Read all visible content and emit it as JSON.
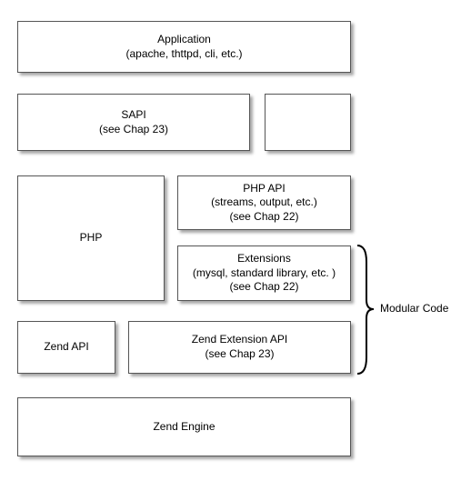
{
  "boxes": {
    "application": {
      "title": "Application",
      "subtitle": "(apache, thttpd, cli, etc.)"
    },
    "sapi": {
      "title": "SAPI",
      "subtitle": "(see Chap 23)"
    },
    "sapi_blank": {
      "title": "",
      "subtitle": ""
    },
    "php": {
      "title": "PHP"
    },
    "php_api": {
      "title": "PHP API",
      "subtitle1": "(streams, output, etc.)",
      "subtitle2": "(see Chap 22)"
    },
    "extensions": {
      "title": "Extensions",
      "subtitle1": "(mysql, standard library, etc. )",
      "subtitle2": "(see Chap 22)"
    },
    "zend_api": {
      "title": "Zend API"
    },
    "zend_ext_api": {
      "title": "Zend Extension API",
      "subtitle": "(see Chap 23)"
    },
    "zend_engine": {
      "title": "Zend Engine"
    }
  },
  "annotation": {
    "modular_code": "Modular Code"
  }
}
